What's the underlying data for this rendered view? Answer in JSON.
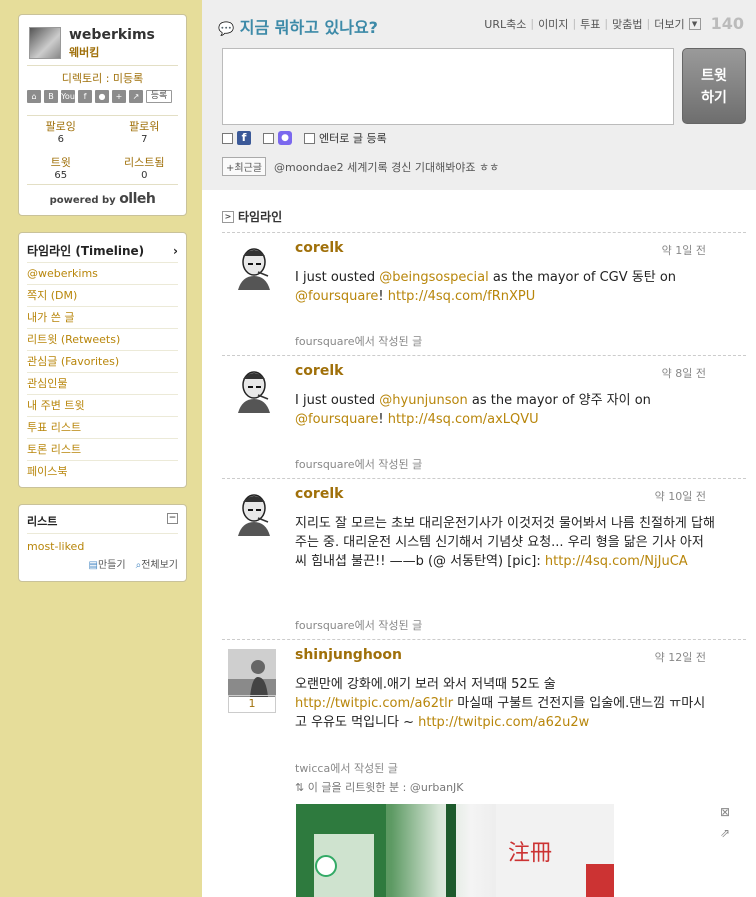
{
  "profile": {
    "username": "weberkims",
    "korean_name": "웨버킴",
    "directory": "디렉토리 : 미등록",
    "register_label": "등록",
    "icons": [
      "home-icon",
      "blog-icon",
      "youtube-icon",
      "facebook-icon",
      "me2day-icon",
      "plus-icon",
      "link-icon"
    ],
    "following_label": "팔로잉",
    "following": "6",
    "followers_label": "팔로워",
    "followers": "7",
    "tweets_label": "트윗",
    "tweets": "65",
    "listed_label": "리스트됨",
    "listed": "0",
    "powered": "powered by",
    "brand": "olleh"
  },
  "nav": {
    "items": [
      "타임라인 (Timeline)",
      "@weberkims",
      "쪽지 (DM)",
      "내가 쓴 글",
      "리트윗 (Retweets)",
      "관심글 (Favorites)",
      "관심인물",
      "내 주변 트윗",
      "투표 리스트",
      "토론 리스트",
      "페이스북"
    ],
    "chevron": "›"
  },
  "lists": {
    "title": "리스트",
    "item": "most-liked",
    "make": "만들기",
    "view_all": "전체보기"
  },
  "compose": {
    "prompt": "지금 뭐하고 있나요?",
    "links": [
      "URL축소",
      "이미지",
      "투표",
      "맞춤법",
      "더보기"
    ],
    "count": "140",
    "tweet_button": [
      "트윗",
      "하기"
    ],
    "enter_label": "엔터로 글 등록",
    "recent_button": "+최근글",
    "recent_text": "@moondae2 세계기록 경신 기대해봐야죠 ㅎㅎ"
  },
  "timeline": {
    "label": "타임라인",
    "tweets": [
      {
        "user": "corelk",
        "time": "약 1일 전",
        "text_parts": [
          "I just ousted ",
          "@beingsospecial",
          " as the mayor of CGV 동탄 on ",
          "@foursquare",
          "! ",
          "http://4sq.com/fRnXPU"
        ],
        "source": "foursquare에서 작성된 글"
      },
      {
        "user": "corelk",
        "time": "약 8일 전",
        "text_parts": [
          "I just ousted ",
          "@hyunjunson",
          " as the mayor of 양주 자이 on ",
          "@foursquare",
          "! ",
          "http://4sq.com/axLQVU"
        ],
        "source": "foursquare에서 작성된 글"
      },
      {
        "user": "corelk",
        "time": "약 10일 전",
        "text_parts": [
          "지리도 잘 모르는 초보 대리운전기사가 이것저것 물어봐서 나름 친절하게 답해 주는 중. 대리운전 시스템 신기해서 기념샷 요청... 우리 형을 닮은 기사 아저씨 힘내셥 불끈!! ——b (@ 서동탄역) [pic]: ",
          "http://4sq.com/NjJuCA"
        ],
        "source": "foursquare에서 작성된 글"
      },
      {
        "user": "shinjunghoon",
        "time": "약 12일 전",
        "count": "1",
        "text_parts": [
          "오랜만에 강화에.애기 보러 와서 저녁때 52도 술 ",
          "http://twitpic.com/a62tlr",
          " 마실때 구불트 건전지를 입술에.댄느낌 ㅠ마시고 우유도 먹입니다 ~ ",
          "http://twitpic.com/a62u2w"
        ],
        "source": "twicca에서 작성된 글",
        "retweeted_by": "이 글을 리트윗한 분 : @urbanJK"
      }
    ]
  }
}
